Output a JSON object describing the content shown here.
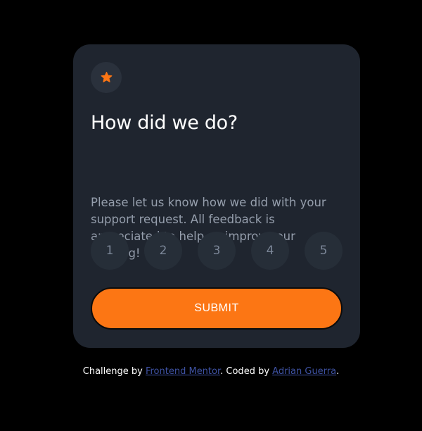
{
  "card": {
    "icon": "star-icon",
    "title": "How did we do?",
    "description": "Please let us know how we did with your support request. All feedback is appreciated to help us improve our offering!",
    "ratings": [
      "1",
      "2",
      "3",
      "4",
      "5"
    ],
    "submit_label": "SUBMIT"
  },
  "attribution": {
    "prefix": "Challenge by ",
    "challenge_link": "Frontend Mentor",
    "middle": ". Coded by ",
    "author_link": "Adrian Guerra",
    "suffix": "."
  },
  "colors": {
    "background": "#000000",
    "card": "#1f252f",
    "accent_orange": "#fc7614",
    "rating_bg": "#262e38",
    "text_muted": "#959eac",
    "link": "#3e52a3"
  }
}
